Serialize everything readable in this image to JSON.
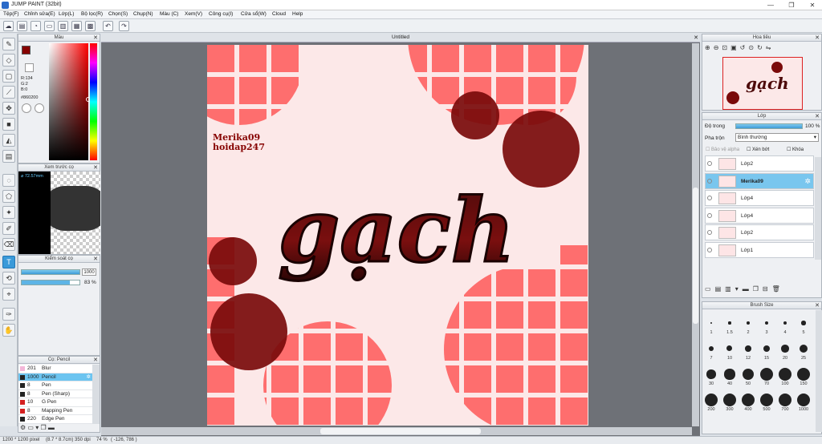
{
  "window": {
    "title": "JUMP PAINT (32bit)",
    "minimize": "—",
    "maximize": "❐",
    "close": "✕"
  },
  "menu": [
    "Tệp(F)",
    "Chỉnh sửa(E)",
    "Lớp(L)",
    "Bộ lọc(R)",
    "Chọn(S)",
    "Chụp(N)",
    "Màu (C)",
    "Xem(V)",
    "Công cụ(I)",
    "Cửa sổ(W)",
    "Cloud",
    "Help"
  ],
  "document": {
    "tab": "Untitled"
  },
  "color_panel": {
    "title": "Màu",
    "r": "R:134",
    "g": "G:2",
    "b": "B:0",
    "hex": "#860200",
    "fg_color": "#860200"
  },
  "preview_panel": {
    "title": "Xem trước cọ",
    "size": "72.57mm"
  },
  "control_panel": {
    "title": "Kiểm soát cọ",
    "size_value": "1000",
    "opacity_value": "83 %",
    "size_level": 1.0,
    "opacity_level": 0.83
  },
  "brush_list": {
    "title": "Cọ: Pencil",
    "items": [
      {
        "size": "201",
        "name": "Blur",
        "color": "#f3b6d8",
        "selected": false
      },
      {
        "size": "1000",
        "name": "Pencil",
        "color": "#222222",
        "selected": true
      },
      {
        "size": "8",
        "name": "Pen",
        "color": "#222222",
        "selected": false
      },
      {
        "size": "8",
        "name": "Pen (Sharp)",
        "color": "#222222",
        "selected": false
      },
      {
        "size": "10",
        "name": "G Pen",
        "color": "#d42020",
        "selected": false
      },
      {
        "size": "8",
        "name": "Mapping Pen",
        "color": "#d42020",
        "selected": false
      },
      {
        "size": "220",
        "name": "Edge Pen",
        "color": "#222222",
        "selected": false
      }
    ]
  },
  "artwork": {
    "credit_line1": "Merika09",
    "credit_line2": "hoidap247",
    "headline": "gạch",
    "bg": "#fce8e8",
    "tile": "#fe6e6e",
    "blob": "#7a0a0a"
  },
  "navigator": {
    "title": "Hoa tiêu"
  },
  "layer_panel": {
    "title": "Lớp",
    "opacity_label": "Độ trong",
    "opacity_value": "100 %",
    "opacity_level": 1.0,
    "blend_label": "Pha trộn",
    "blend_value": "Bình thường",
    "protect_alpha": "Bảo vệ alpha",
    "clipping": "Xén bớt",
    "lock": "Khóa",
    "layers": [
      {
        "name": "Lớp2",
        "selected": false
      },
      {
        "name": "Merika09",
        "selected": true
      },
      {
        "name": "Lớp4",
        "selected": false
      },
      {
        "name": "Lớp4",
        "selected": false
      },
      {
        "name": "Lớp2",
        "selected": false
      },
      {
        "name": "Lớp1",
        "selected": false
      }
    ]
  },
  "brush_size_panel": {
    "title": "Brush Size",
    "sizes": [
      "1",
      "1.5",
      "2",
      "3",
      "4",
      "5",
      "7",
      "10",
      "12",
      "15",
      "20",
      "25",
      "30",
      "40",
      "50",
      "70",
      "100",
      "150",
      "200",
      "300",
      "400",
      "500",
      "700",
      "1000"
    ]
  },
  "status": {
    "dims": "1200 * 1200 pixel",
    "phys": "(8.7 * 8.7cm)",
    "dpi": "350 dpi",
    "zoom": "74 %",
    "coords": "( -126, 786 )"
  }
}
